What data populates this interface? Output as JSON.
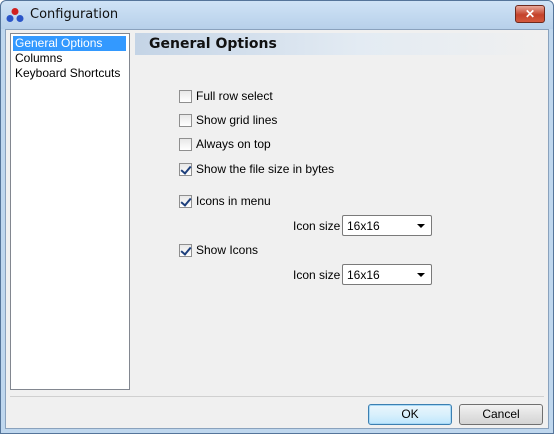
{
  "window": {
    "title": "Configuration",
    "close_glyph": "✕"
  },
  "nav": {
    "items": [
      {
        "label": "General Options",
        "selected": true
      },
      {
        "label": "Columns",
        "selected": false
      },
      {
        "label": "Keyboard Shortcuts",
        "selected": false
      }
    ]
  },
  "panel": {
    "title": "General Options",
    "options": [
      {
        "label": "Full row select",
        "checked": false
      },
      {
        "label": "Show grid lines",
        "checked": false
      },
      {
        "label": "Always on top",
        "checked": false
      },
      {
        "label": "Show the file size in bytes",
        "checked": true
      },
      {
        "label": "Icons in menu",
        "checked": true
      },
      {
        "label": "Show Icons",
        "checked": true
      }
    ],
    "menu_icon_size": {
      "label": "Icon size",
      "value": "16x16"
    },
    "icon_size": {
      "label": "Icon size",
      "value": "16x16"
    }
  },
  "buttons": {
    "ok": "OK",
    "cancel": "Cancel"
  },
  "icons": {
    "app": "app-icon",
    "close": "close-icon",
    "checkmark": "checkmark-icon",
    "dropdown": "chevron-down-icon"
  },
  "colors": {
    "selection": "#3399ff",
    "titlebar": "#b7d0ea",
    "close_button": "#c4422b"
  }
}
